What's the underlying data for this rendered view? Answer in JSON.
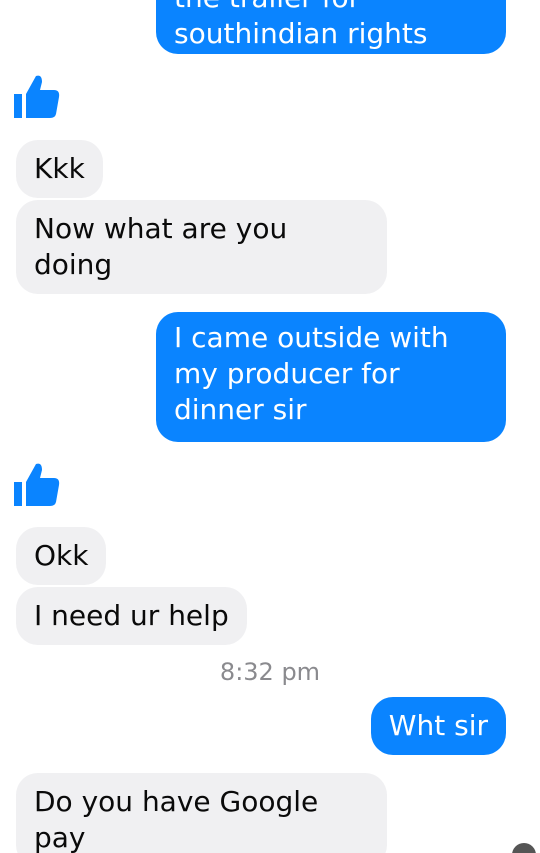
{
  "messages": {
    "m1": "the trailer for\nsouthindian rights",
    "m2": "Kkk",
    "m3": "Now what are you\ndoing",
    "m4": "I came outside with\nmy producer for\ndinner sir",
    "m5": "Okk",
    "m6": "I need ur help",
    "m7": "Wht sir",
    "m8": "Do you have Google\npay"
  },
  "timestamp": "8:32 pm",
  "icons": {
    "like": "thumbs-up-icon",
    "avatar": "avatar"
  },
  "colors": {
    "outgoing_bubble": "#0a84ff",
    "incoming_bubble": "#f0f0f2",
    "like_icon": "#0a84ff",
    "timestamp": "#8a8a8e"
  }
}
